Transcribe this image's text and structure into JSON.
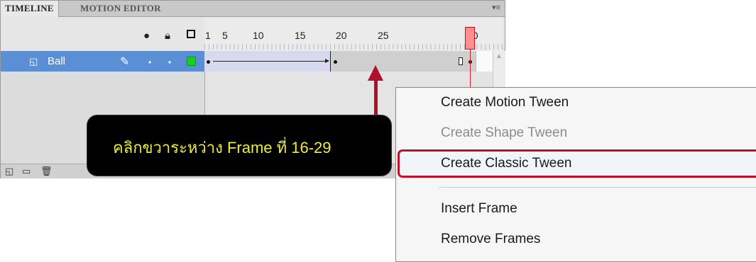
{
  "panel": {
    "tabs": [
      "TIMELINE",
      "MOTION EDITOR"
    ],
    "menu_icon": "≡"
  },
  "ruler": {
    "frames": [
      "1",
      "5",
      "10",
      "15",
      "20",
      "25",
      "30"
    ]
  },
  "layer": {
    "name": "Ball"
  },
  "callout": {
    "text": "คลิกขวาระหว่าง  Frame ที่ 16-29"
  },
  "context_menu": {
    "items": [
      {
        "label": "Create Motion Tween",
        "enabled": true
      },
      {
        "label": "Create Shape Tween",
        "enabled": false
      },
      {
        "label": "Create Classic Tween",
        "enabled": true,
        "highlighted": true
      },
      {
        "label": "Insert Frame",
        "enabled": true
      },
      {
        "label": "Remove Frames",
        "enabled": true
      }
    ]
  },
  "colors": {
    "layer_selected": "#5a8fd6",
    "playhead": "#ff8f8f",
    "callout_text": "#f2ec35",
    "highlight_border": "#c0112a"
  }
}
